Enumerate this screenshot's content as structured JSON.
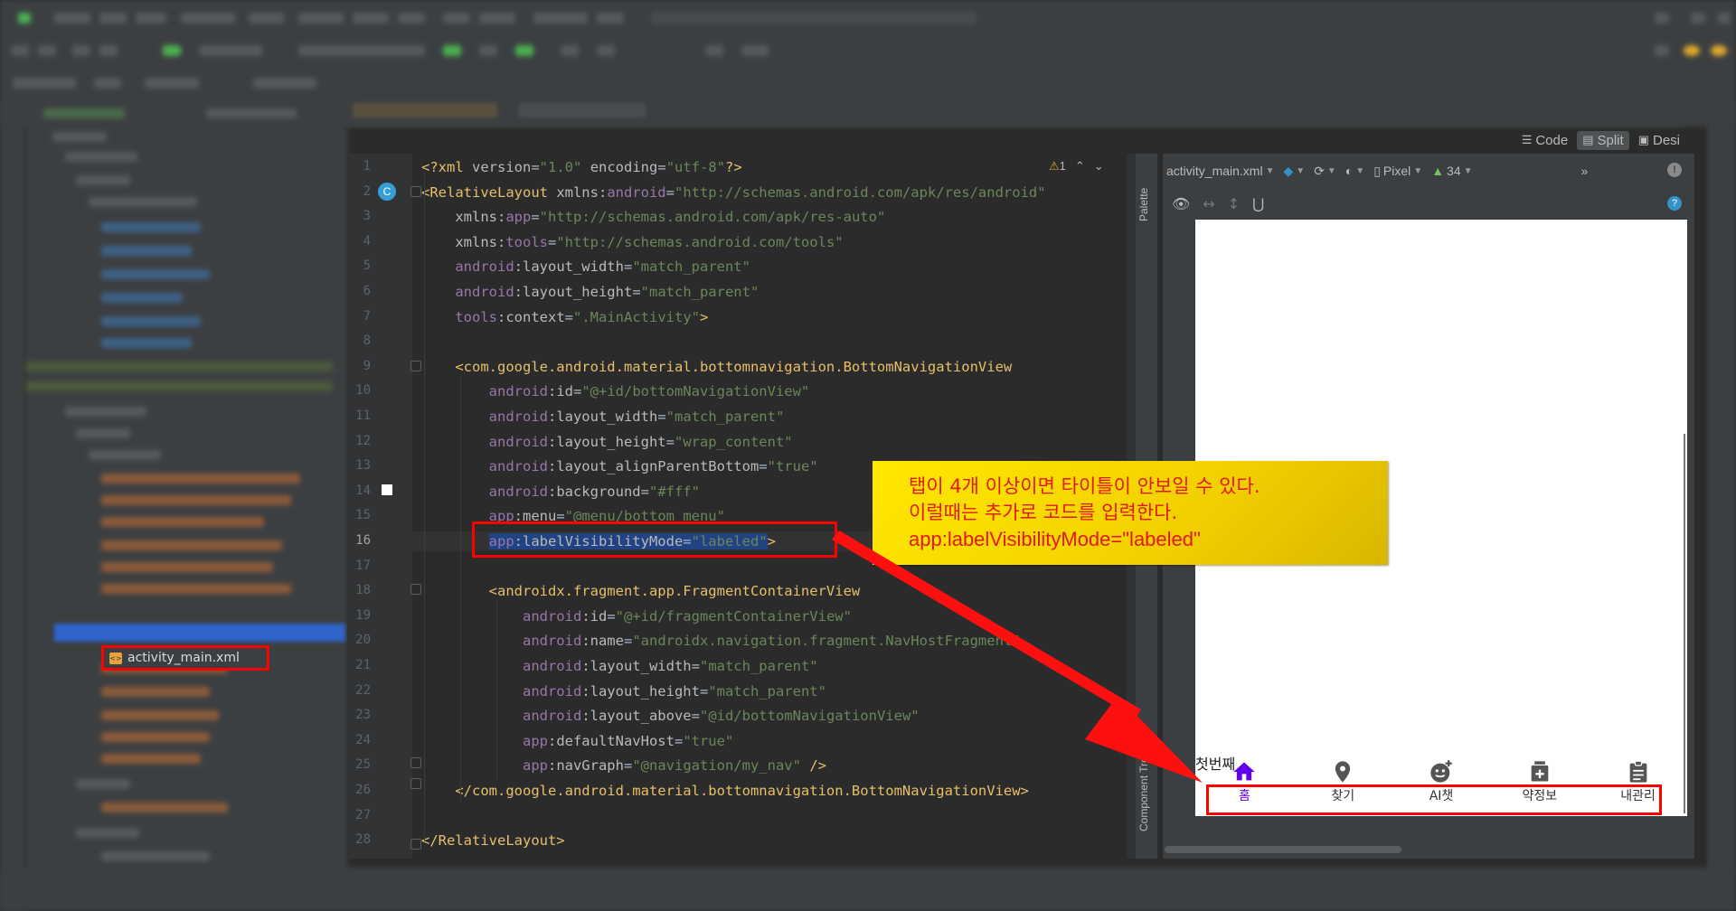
{
  "editor": {
    "lines": [
      {
        "n": "1",
        "html": "<span class='t-pi'>&lt;?xml </span><span class='t-attr'>version</span>=<span class='t-val'>\"1.0\"</span> <span class='t-attr'>encoding</span>=<span class='t-val'>\"utf-8\"</span><span class='t-pi'>?&gt;</span>"
      },
      {
        "n": "2",
        "html": "<span class='t-tag'>&lt;RelativeLayout </span><span class='t-attr'>xmlns:</span><span class='t-ns'>android</span>=<span class='t-val'>\"http://schemas.android.com/apk/res/android\"</span>"
      },
      {
        "n": "3",
        "html": "    <span class='t-attr'>xmlns:</span><span class='t-ns'>app</span>=<span class='t-val'>\"http://schemas.android.com/apk/res-auto\"</span>"
      },
      {
        "n": "4",
        "html": "    <span class='t-attr'>xmlns:</span><span class='t-ns'>tools</span>=<span class='t-val'>\"http://schemas.android.com/tools\"</span>"
      },
      {
        "n": "5",
        "html": "    <span class='t-ns'>android</span><span class='t-attr'>:layout_width</span>=<span class='t-val'>\"match_parent\"</span>"
      },
      {
        "n": "6",
        "html": "    <span class='t-ns'>android</span><span class='t-attr'>:layout_height</span>=<span class='t-val'>\"match_parent\"</span>"
      },
      {
        "n": "7",
        "html": "    <span class='t-ns'>tools</span><span class='t-attr'>:context</span>=<span class='t-val'>\".MainActivity\"</span><span class='t-tag'>&gt;</span>"
      },
      {
        "n": "8",
        "html": ""
      },
      {
        "n": "9",
        "html": "    <span class='t-tag'>&lt;com.google.android.material.bottomnavigation.BottomNavigationView</span>"
      },
      {
        "n": "10",
        "html": "        <span class='t-ns'>android</span><span class='t-attr'>:id</span>=<span class='t-val'>\"@+id/bottomNavigationView\"</span>"
      },
      {
        "n": "11",
        "html": "        <span class='t-ns'>android</span><span class='t-attr'>:layout_width</span>=<span class='t-val'>\"match_parent\"</span>"
      },
      {
        "n": "12",
        "html": "        <span class='t-ns'>android</span><span class='t-attr'>:layout_height</span>=<span class='t-val'>\"wrap_content\"</span>"
      },
      {
        "n": "13",
        "html": "        <span class='t-ns'>android</span><span class='t-attr'>:layout_alignParentBottom</span>=<span class='t-val'>\"true\"</span>"
      },
      {
        "n": "14",
        "html": "        <span class='t-ns'>android</span><span class='t-attr'>:background</span>=<span class='t-val'>\"#fff\"</span>"
      },
      {
        "n": "15",
        "html": "        <span class='t-ns'>app</span><span class='t-attr'>:menu</span>=<span class='t-val'>\"@menu/bottom_menu\"</span>"
      },
      {
        "n": "16",
        "html": "        <span class='t-sel'><span class='t-ns'>app</span><span class='t-attr'>:labelVisibilityMode</span>=<span class='t-val'>\"labeled\"</span></span><span class='t-tag'>&gt;</span>",
        "current": true
      },
      {
        "n": "17",
        "html": ""
      },
      {
        "n": "18",
        "html": "        <span class='t-tag'>&lt;androidx.fragment.app.FragmentContainerView</span>"
      },
      {
        "n": "19",
        "html": "            <span class='t-ns'>android</span><span class='t-attr'>:id</span>=<span class='t-val'>\"@+id/fragmentContainerView\"</span>"
      },
      {
        "n": "20",
        "html": "            <span class='t-ns'>android</span><span class='t-attr'>:name</span>=<span class='t-val'>\"androidx.navigation.fragment.NavHostFragment\"</span>"
      },
      {
        "n": "21",
        "html": "            <span class='t-ns'>android</span><span class='t-attr'>:layout_width</span>=<span class='t-val'>\"match_parent\"</span>"
      },
      {
        "n": "22",
        "html": "            <span class='t-ns'>android</span><span class='t-attr'>:layout_height</span>=<span class='t-val'>\"match_parent\"</span>"
      },
      {
        "n": "23",
        "html": "            <span class='t-ns'>android</span><span class='t-attr'>:layout_above</span>=<span class='t-val'>\"@id/bottomNavigationView\"</span>"
      },
      {
        "n": "24",
        "html": "            <span class='t-ns'>app</span><span class='t-attr'>:defaultNavHost</span>=<span class='t-val'>\"true\"</span>"
      },
      {
        "n": "25",
        "html": "            <span class='t-ns'>app</span><span class='t-attr'>:navGraph</span>=<span class='t-val'>\"@navigation/my_nav\"</span> <span class='t-tag'>/&gt;</span>"
      },
      {
        "n": "26",
        "html": "    <span class='t-tag'>&lt;/com.google.android.material.bottomnavigation.BottomNavigationView&gt;</span>"
      },
      {
        "n": "27",
        "html": ""
      },
      {
        "n": "28",
        "html": "<span class='t-tag'>&lt;/RelativeLayout&gt;</span>"
      }
    ],
    "warning_count": "1",
    "badge": "C"
  },
  "view_toggle": {
    "code": "Code",
    "split": "Split",
    "design": "Desi"
  },
  "project": {
    "selected_file": "activity_main.xml"
  },
  "side_tabs": {
    "palette": "Palette",
    "component_tree": "Component Tree"
  },
  "design": {
    "file": "activity_main.xml",
    "device": "Pixel",
    "api": "34",
    "fragment_text": "첫번째",
    "nav_items": [
      {
        "label": "홈",
        "icon": "home-icon",
        "active": true
      },
      {
        "label": "찾기",
        "icon": "location-pin-icon",
        "active": false
      },
      {
        "label": "AI챗",
        "icon": "ai-chat-icon",
        "active": false
      },
      {
        "label": "약정보",
        "icon": "medicine-box-icon",
        "active": false
      },
      {
        "label": "내관리",
        "icon": "clipboard-icon",
        "active": false
      }
    ],
    "active_color": "#6200ee"
  },
  "callout": {
    "line1": "탭이 4개 이상이면 타이틀이 안보일 수 있다.",
    "line2": "이럴때는 추가로 코드를 입력한다.",
    "line3": "app:labelVisibilityMode=\"labeled\"",
    "text_color": "#e01a1a",
    "bg_color": "#ffe800"
  }
}
